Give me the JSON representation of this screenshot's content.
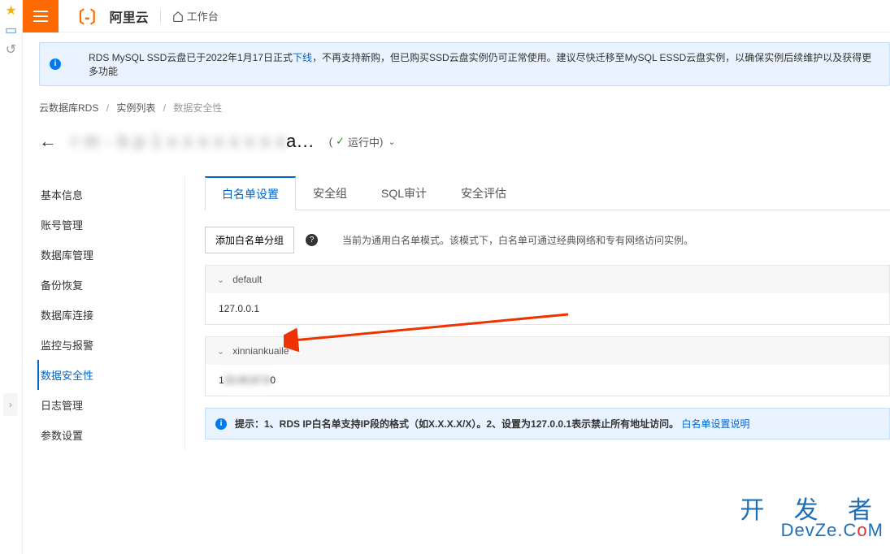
{
  "topbar": {
    "logo": "阿里云",
    "workbench": "工作台"
  },
  "alert": {
    "pre": "RDS MySQL SSD云盘已于2022年1月17日正式",
    "link": "下线",
    "post": "，不再支持新购，但已购买SSD云盘实例仍可正常使用。建议尽快迁移至MySQL ESSD云盘实例，以确保实例后续维护以及获得更多功能"
  },
  "crumbs": {
    "a": "云数据库RDS",
    "b": "实例列表",
    "c": "数据安全性"
  },
  "title": {
    "mask": "r m - b p 1 x x x x x x x x",
    "suffix": "a...",
    "status_open": "(",
    "check": "✓",
    "status": "运行中",
    "status_close": ")"
  },
  "nav": [
    "基本信息",
    "账号管理",
    "数据库管理",
    "备份恢复",
    "数据库连接",
    "监控与报警",
    "数据安全性",
    "日志管理",
    "参数设置"
  ],
  "nav_active": 6,
  "tabs": [
    "白名单设置",
    "安全组",
    "SQL审计",
    "安全评估"
  ],
  "toolbar": {
    "add": "添加白名单分组",
    "desc": "当前为通用白名单模式。该模式下，白名单可通过经典网络和专有网络访问实例。"
  },
  "groups": [
    {
      "name": "default",
      "body": "127.0.0.1"
    },
    {
      "name": "xinniankuaile",
      "body_pre": "1",
      "body_blur": "23.45.67.8",
      "body_post": "0"
    }
  ],
  "tip": {
    "label": "提示：1、RDS IP白名单支持IP段的格式（如X.X.X.X/X）。2、设置为127.0.0.1表示禁止所有地址访问。",
    "link": "白名单设置说明"
  },
  "watermark": {
    "line1": "开 发 者",
    "line2_pre": "DevZe.C",
    "line2_o": "o",
    "line2_post": "M"
  }
}
